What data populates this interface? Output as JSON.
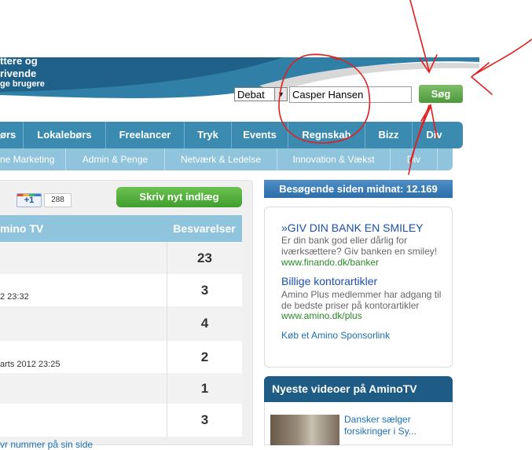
{
  "header": {
    "logo_lines": [
      "ttere og",
      "rivende",
      "ge brugere"
    ],
    "search": {
      "category": "Debat",
      "query": "Casper Hansen",
      "button": "Søg"
    }
  },
  "nav_main": [
    "ørs",
    "Lokalebørs",
    "Freelancer",
    "Tryk",
    "Events",
    "Regnskab",
    "Bizz",
    "Div"
  ],
  "nav_sub": [
    "ne Marketing",
    "Admin & Penge",
    "Netværk & Ledelse",
    "Innovation & Vækst",
    "Div"
  ],
  "left": {
    "gplus_label": "+1",
    "gplus_count": "288",
    "write_button": "Skriv nyt indlæg",
    "table_header_title": "mino TV",
    "table_header_replies": "Besvarelser",
    "rows": [
      {
        "title": "",
        "count": "23"
      },
      {
        "title": "2 23:32",
        "count": "3"
      },
      {
        "title": "",
        "count": "4"
      },
      {
        "title": "arts 2012 23:25",
        "count": "2"
      },
      {
        "title": "",
        "count": "1"
      },
      {
        "title": "",
        "count": "3"
      }
    ],
    "bottom_link": "vr nummer på sin side"
  },
  "right": {
    "visitors": "Besøgende siden midnat: 12.169",
    "ads": [
      {
        "title": "»GIV DIN BANK EN SMILEY",
        "text": "Er din bank god eller dårlig for iværksættere? Giv banken en smiley!",
        "url": "www.finando.dk/banker"
      },
      {
        "title": "Billige kontorartikler",
        "text": "Amino Plus medlemmer har adgang til de bedste priser på kontorartikler",
        "url": "www.amino.dk/plus"
      }
    ],
    "sponsor_link": "Køb et Amino Sponsorlink",
    "videos_heading": "Nyeste videoer på AminoTV",
    "video_title": "Dansker sælger forsikringer i Sy..."
  },
  "colors": {
    "nav_main": "#3b8bb0",
    "nav_sub": "#8fc4dc",
    "search_button": "#5aa645",
    "annotation": "#e02020"
  }
}
